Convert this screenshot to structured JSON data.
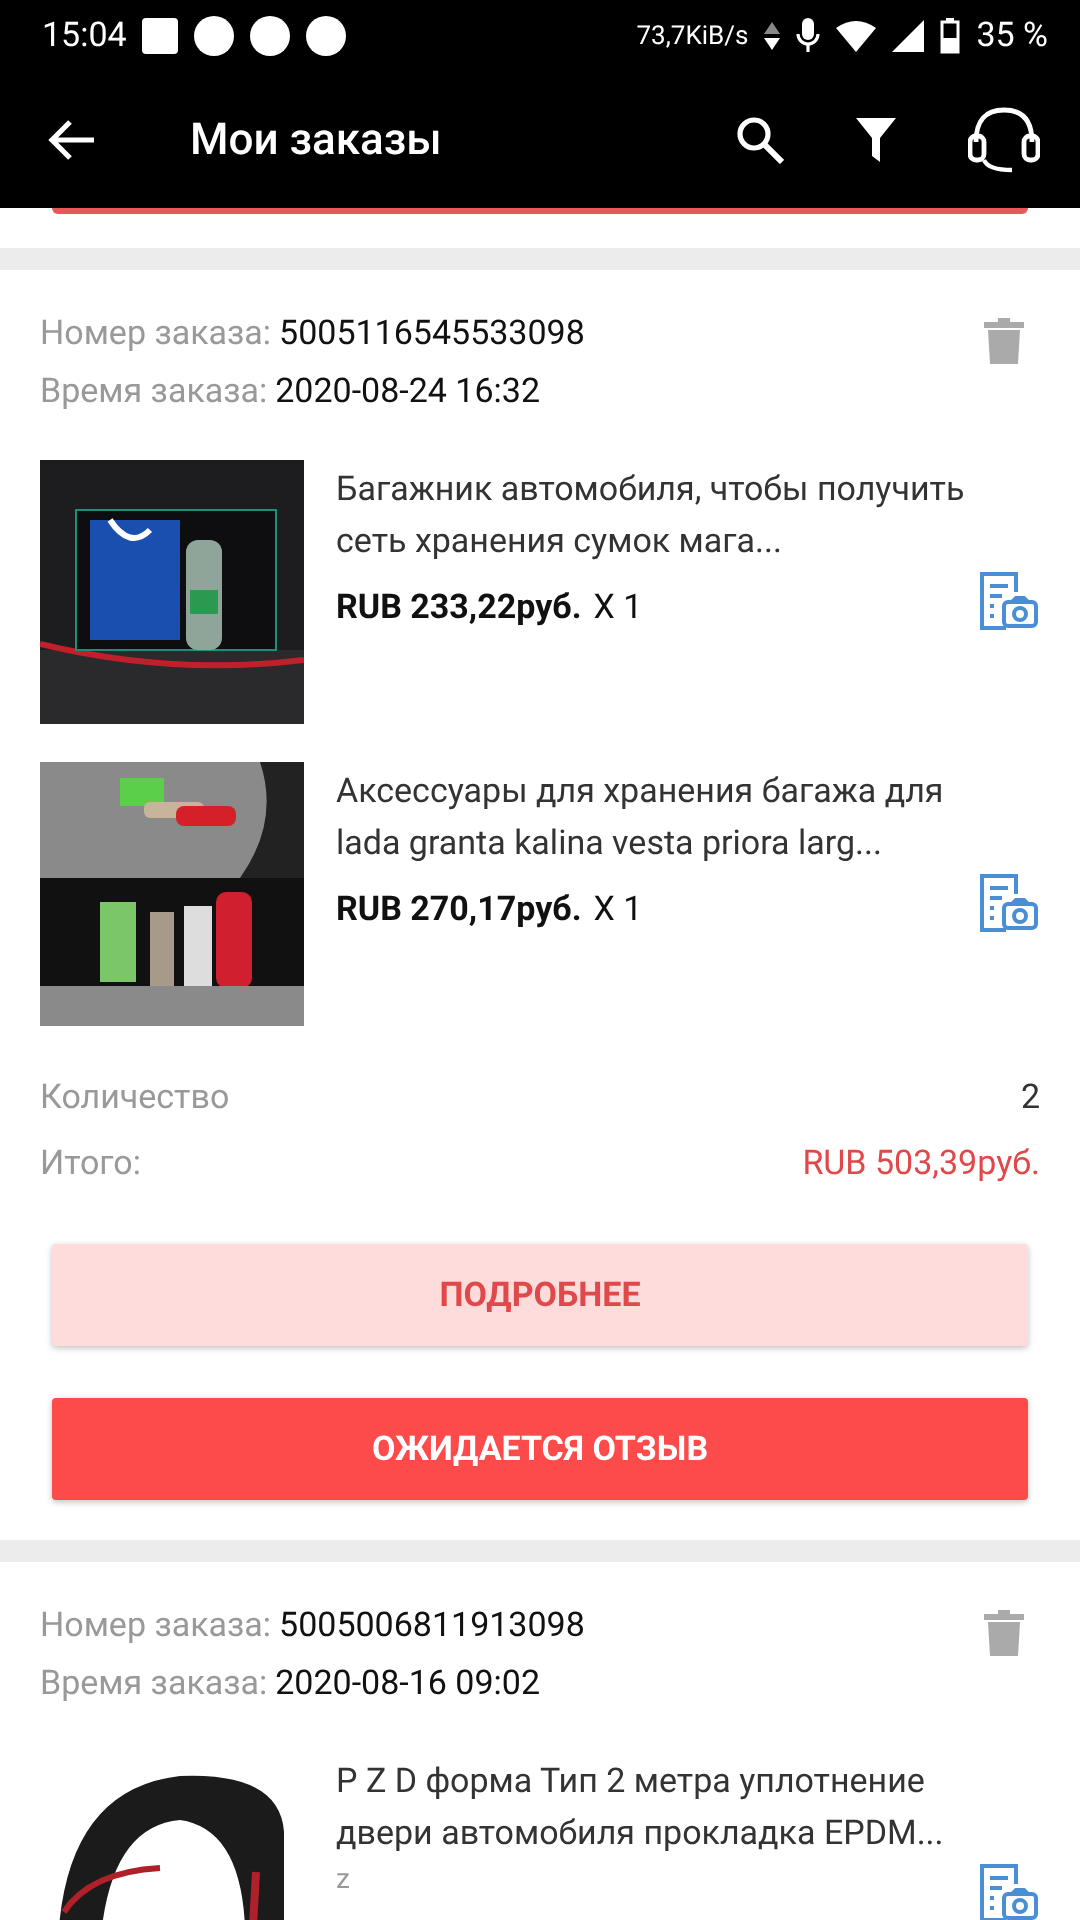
{
  "status_bar": {
    "time": "15:04",
    "speed": "73,7KiB/s",
    "battery": "35 %"
  },
  "app_bar": {
    "title": "Мои заказы"
  },
  "orders": [
    {
      "number_label": "Номер заказа:",
      "number": "5005116545533098",
      "time_label": "Время заказа:",
      "time": "2020-08-24 16:32",
      "items": [
        {
          "title": "Багажник автомобиля, чтобы получить сеть хранения сумок мага...",
          "price": "RUB 233,22руб.",
          "qty": "X 1"
        },
        {
          "title": "Аксессуары для хранения багажа для lada granta kalina vesta priora larg...",
          "price": "RUB 270,17руб.",
          "qty": "X 1"
        }
      ],
      "quantity_label": "Количество",
      "quantity": "2",
      "total_label": "Итого:",
      "total": "RUB 503,39руб.",
      "details_button": "ПОДРОБНЕЕ",
      "review_button": "ОЖИДАЕТСЯ ОТЗЫВ"
    },
    {
      "number_label": "Номер заказа:",
      "number": "5005006811913098",
      "time_label": "Время заказа:",
      "time": "2020-08-16 09:02",
      "items": [
        {
          "title": "P Z D форма Тип 2 метра уплотнение двери автомобиля прокладка EPDM...",
          "variant": "z"
        }
      ]
    }
  ]
}
